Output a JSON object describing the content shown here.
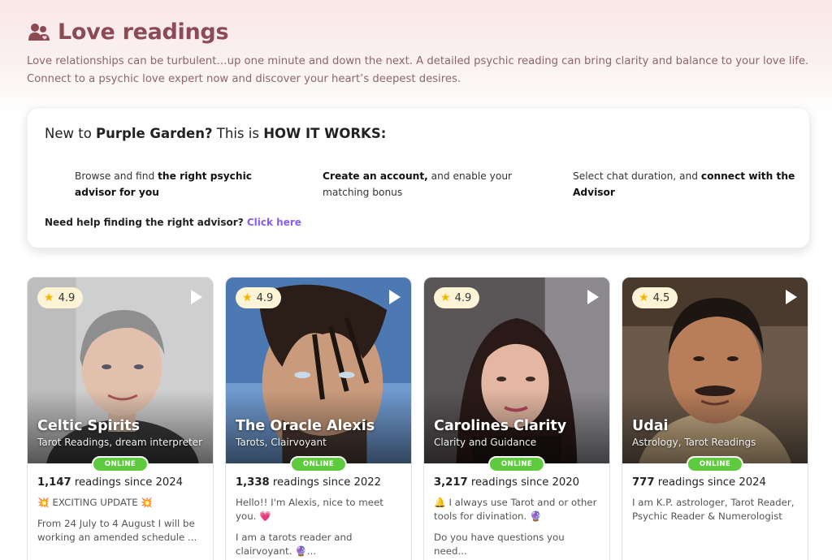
{
  "header": {
    "title": "Love readings",
    "subtitle": "Love relationships can be turbulent…up one minute and down the next. A detailed psychic reading can bring clarity and balance to your love life. Connect to a psychic love expert now and discover your heart’s deepest desires.",
    "icon": "couple-icon"
  },
  "how": {
    "prefix": "New to ",
    "brand": "Purple Garden?",
    "middle": " This is ",
    "emph": "HOW IT WORKS:",
    "steps": [
      {
        "pre": "Browse and find ",
        "bold": "the right psychic advisor for you",
        "post": ""
      },
      {
        "pre": "",
        "bold": "Create an account,",
        "post": " and enable your matching bonus"
      },
      {
        "pre": "Select chat duration, and ",
        "bold": "connect with the Advisor",
        "post": ""
      }
    ],
    "help_text": "Need help finding the right advisor?",
    "help_link": "Click here"
  },
  "advisors": [
    {
      "rating": "4.9",
      "name": "Celtic Spirits",
      "specialty": "Tarot Readings, dream interpreter",
      "status": "ONLINE",
      "readings_count": "1,147",
      "readings_suffix": " readings since 2024",
      "desc1": "💥 EXCITING UPDATE 💥",
      "desc2": "From 24 July to 4 August I will be working an amended schedule ..."
    },
    {
      "rating": "4.9",
      "name": "The Oracle Alexis",
      "specialty": "Tarots, Clairvoyant",
      "status": "ONLINE",
      "readings_count": "1,338",
      "readings_suffix": " readings since 2022",
      "desc1": "Hello!! I'm Alexis, nice to meet you. 💗",
      "desc2": "I am a tarots reader and clairvoyant. 🔮..."
    },
    {
      "rating": "4.9",
      "name": "Carolines Clarity",
      "specialty": "Clarity and Guidance",
      "status": "ONLINE",
      "readings_count": "3,217",
      "readings_suffix": " readings since 2020",
      "desc1": "🔔 I always use Tarot and or other tools for divination. 🔮",
      "desc2": "Do you have questions you need..."
    },
    {
      "rating": "4.5",
      "name": "Udai",
      "specialty": "Astrology, Tarot Readings",
      "status": "ONLINE",
      "readings_count": "777",
      "readings_suffix": " readings since 2024",
      "desc1": "I am K.P. astrologer, Tarot Reader, Psychic Reader & Numerologist",
      "desc2": ""
    }
  ],
  "colors": {
    "title": "#8c4a55",
    "link": "#8a5cf0",
    "online": "#5ecb3e",
    "rating_bg": "#fdf3d6",
    "star": "#f5b400"
  }
}
